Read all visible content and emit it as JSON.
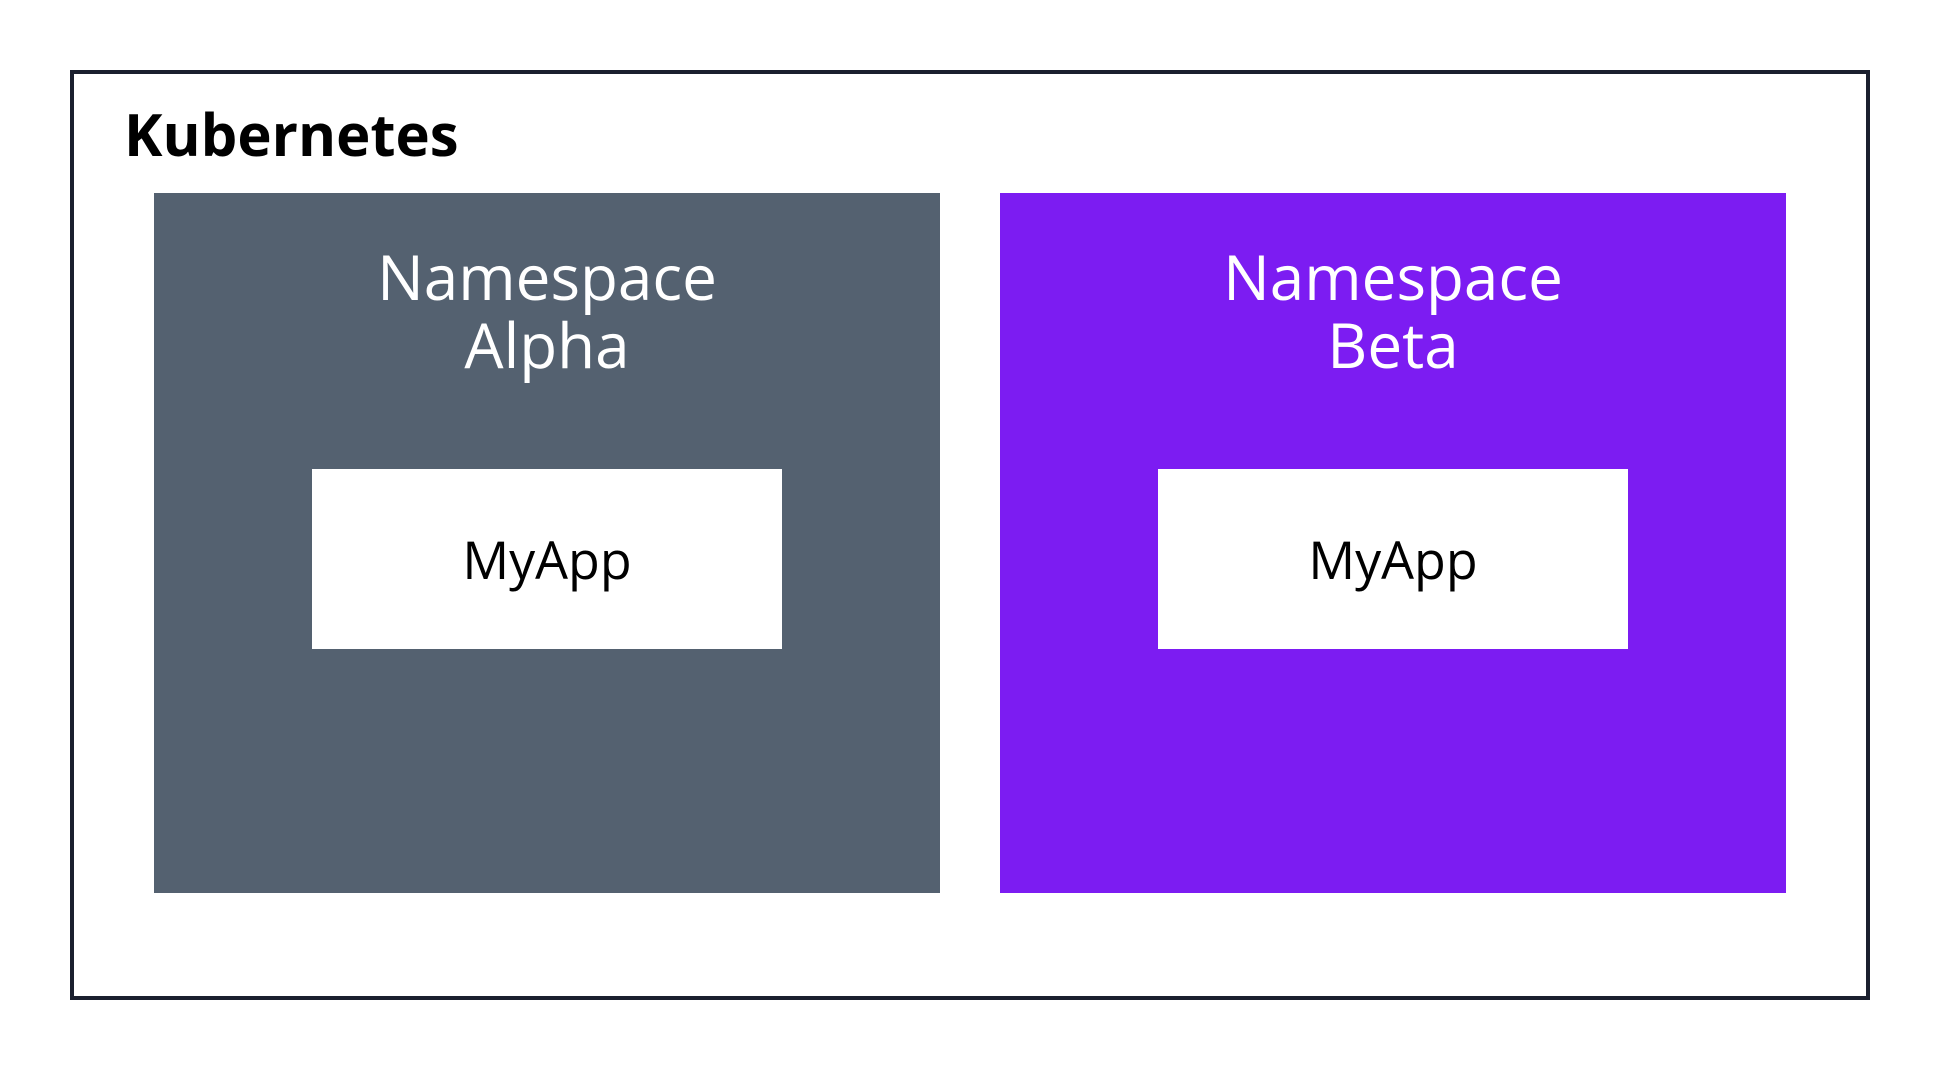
{
  "diagram": {
    "outer_title": "Kubernetes",
    "namespaces": [
      {
        "title_line1": "Namespace",
        "title_line2": "Alpha",
        "app_label": "MyApp",
        "color": "#546170"
      },
      {
        "title_line1": "Namespace",
        "title_line2": "Beta",
        "app_label": "MyApp",
        "color": "#7c1cf2"
      }
    ]
  }
}
